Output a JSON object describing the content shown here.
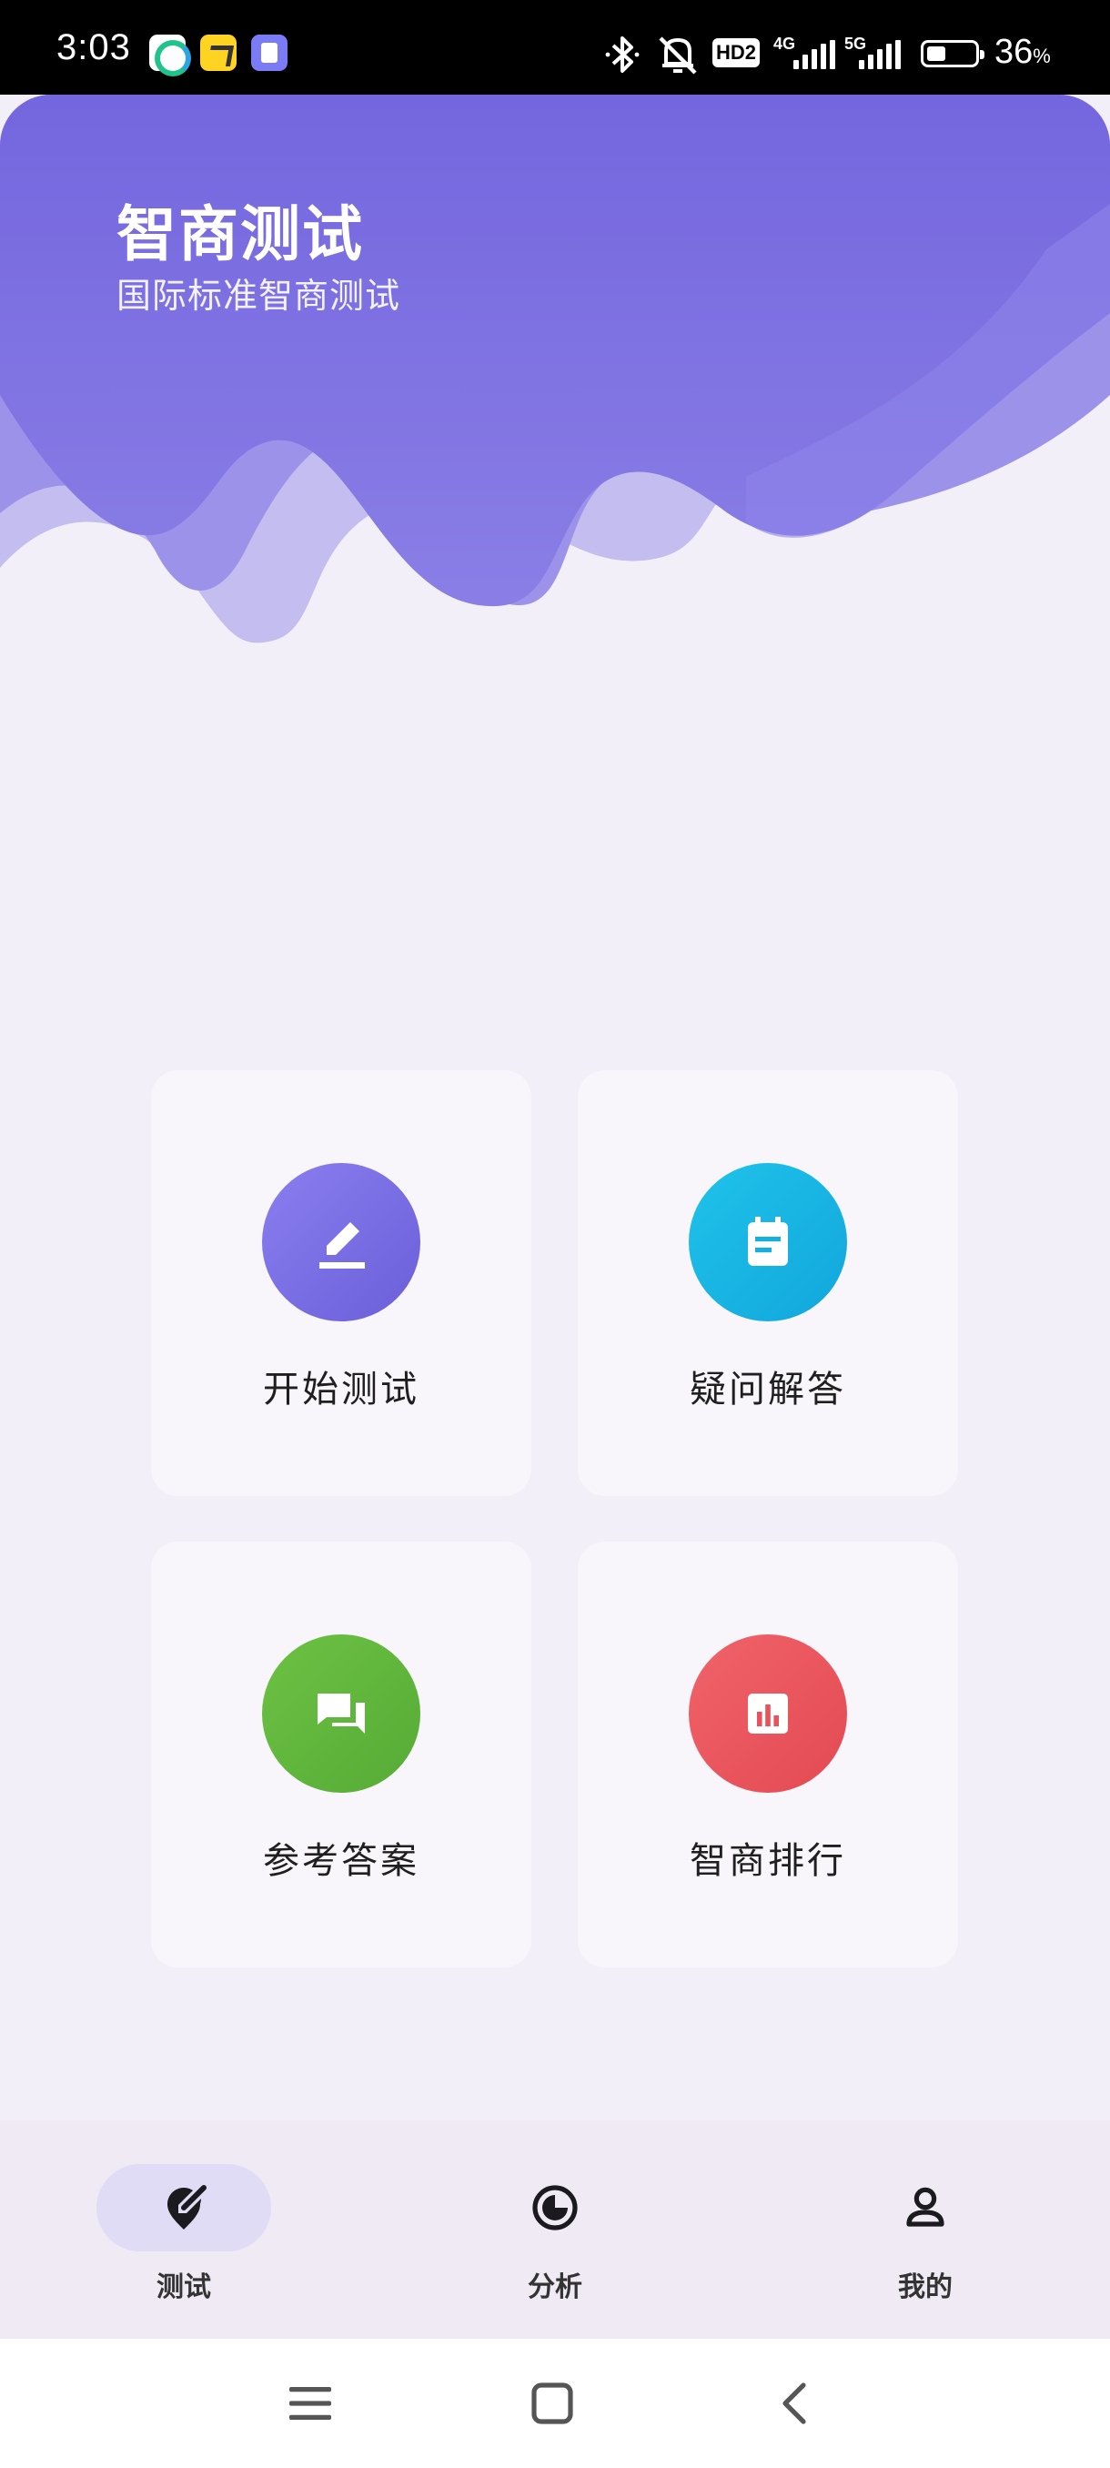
{
  "status_bar": {
    "time": "3:03",
    "net_4g": "4G",
    "net_5g": "5G",
    "hd": "HD2",
    "battery_percent": "36",
    "battery_unit": "%",
    "battery_level": 0.36
  },
  "header": {
    "title": "智商测试",
    "subtitle": "国际标准智商测试",
    "gradient_top": "#7466de",
    "gradient_bottom": "#8a7ee6"
  },
  "cards": [
    {
      "label": "开始测试",
      "icon": "edit-pen-icon",
      "color": "#7a6ee0"
    },
    {
      "label": "疑问解答",
      "icon": "calendar-note-icon",
      "color": "#19b6e3"
    },
    {
      "label": "参考答案",
      "icon": "chat-bubbles-icon",
      "color": "#64b83e"
    },
    {
      "label": "智商排行",
      "icon": "bar-chart-icon",
      "color": "#ec5158"
    }
  ],
  "bottom_nav": {
    "active_pill_color": "#e1dcf6",
    "items": [
      {
        "label": "测试",
        "icon": "test-pen-icon",
        "active": true
      },
      {
        "label": "分析",
        "icon": "analysis-pie-icon",
        "active": false
      },
      {
        "label": "我的",
        "icon": "profile-person-icon",
        "active": false
      }
    ]
  },
  "system_nav": {
    "menu_icon": "menu-icon",
    "home_icon": "home-square-icon",
    "back_icon": "back-chevron-icon"
  }
}
